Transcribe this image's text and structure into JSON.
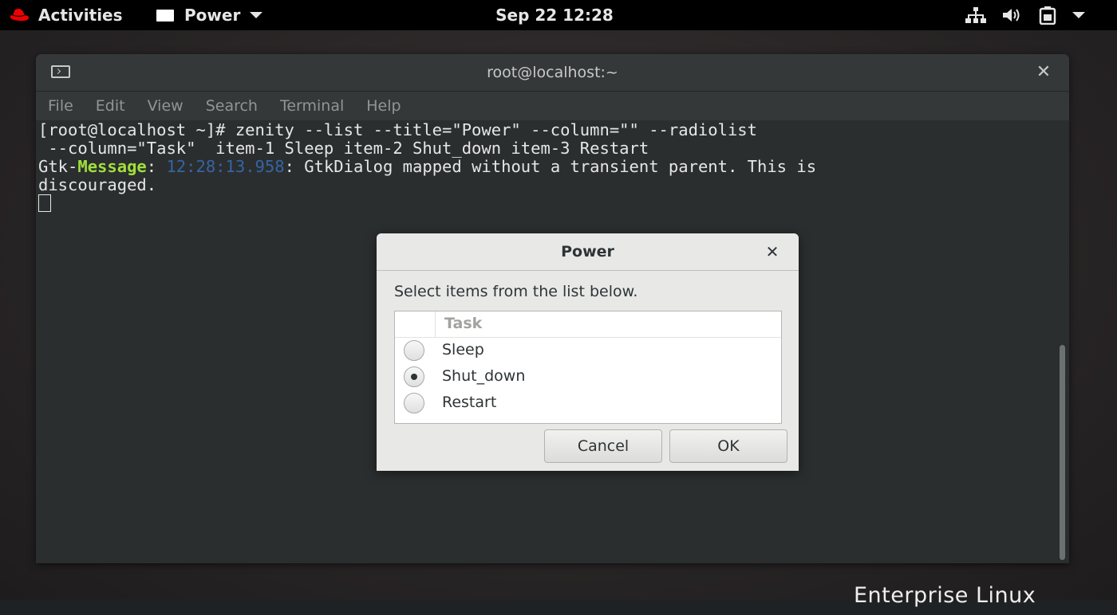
{
  "topbar": {
    "activities_label": "Activities",
    "app_menu_label": "Power",
    "clock": "Sep 22  12:28",
    "tray_icons": [
      "network-icon",
      "volume-icon",
      "battery-icon",
      "system-menu-chevron-icon"
    ]
  },
  "desktop": {
    "brand_text": "Enterprise Linux"
  },
  "terminal": {
    "title": "root@localhost:~",
    "menu": [
      "File",
      "Edit",
      "View",
      "Search",
      "Terminal",
      "Help"
    ],
    "lines": {
      "line1": "[root@localhost ~]# zenity --list --title=\"Power\" --column=\"\" --radiolist",
      "line2": " --column=\"Task\"  item-1 Sleep item-2 Shut_down item-3 Restart",
      "line3_prefix": "Gtk-",
      "line3_keyword": "Message",
      "line3_sep": ": ",
      "line3_timestamp": "12:28:13.958",
      "line3_rest": ": GtkDialog mapped without a transient parent. This is",
      "line4": "discouraged."
    }
  },
  "dialog": {
    "title": "Power",
    "prompt": "Select items from the list below.",
    "column_header": "Task",
    "rows": [
      {
        "label": "Sleep",
        "selected": false
      },
      {
        "label": "Shut_down",
        "selected": true
      },
      {
        "label": "Restart",
        "selected": false
      }
    ],
    "cancel_label": "Cancel",
    "ok_label": "OK"
  },
  "colors": {
    "gtk_message_keyword": "#a0df3b",
    "timestamp": "#3465a4",
    "redhat_red": "#ee0000"
  }
}
